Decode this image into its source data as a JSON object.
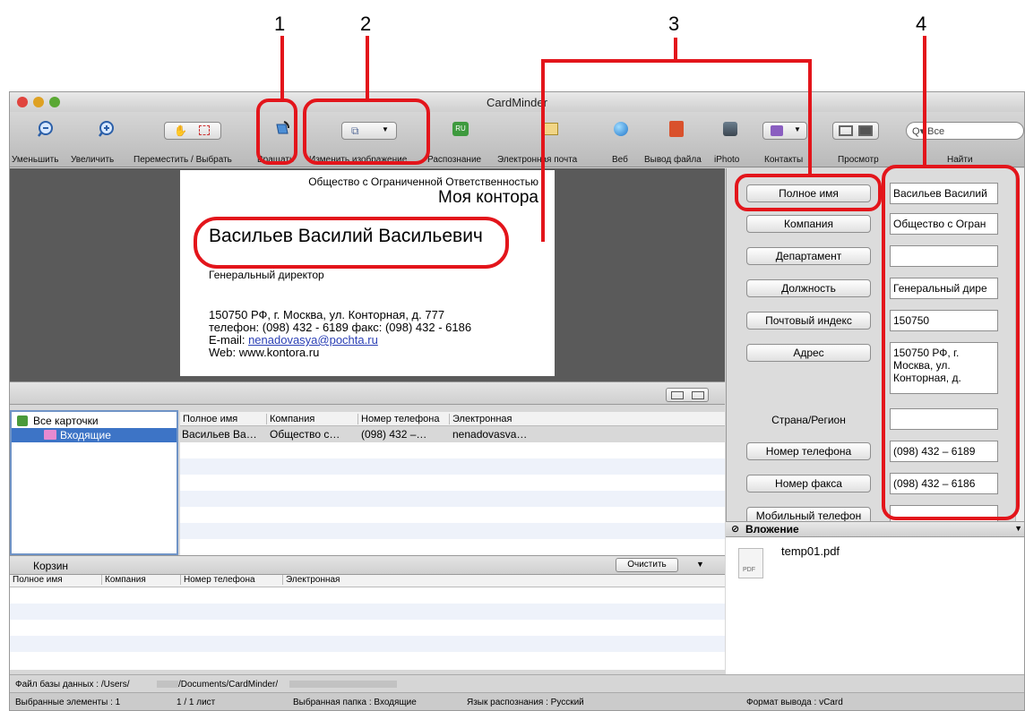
{
  "callouts": [
    "1",
    "2",
    "3",
    "4"
  ],
  "window": {
    "title": "CardMinder"
  },
  "toolbar": {
    "items": [
      {
        "label": "Уменьшить",
        "icon": "zoom-out-icon"
      },
      {
        "label": "Увеличить",
        "icon": "zoom-in-icon"
      },
      {
        "label": "Переместить / Выбрать",
        "icon": "hand-select-icon"
      },
      {
        "label": "Вращать",
        "icon": "rotate-icon"
      },
      {
        "label": "Изменить изображение",
        "icon": "edit-image-icon"
      },
      {
        "label": "Распознание",
        "icon": "recognize-icon"
      },
      {
        "label": "Электронная почта",
        "icon": "mail-icon"
      },
      {
        "label": "Веб",
        "icon": "web-icon"
      },
      {
        "label": "Вывод файла",
        "icon": "file-output-icon"
      },
      {
        "label": "iPhoto",
        "icon": "iphoto-icon"
      },
      {
        "label": "Контакты",
        "icon": "contacts-icon"
      },
      {
        "label": "Просмотр",
        "icon": "view-icon"
      },
      {
        "label": "Найти",
        "icon": "search-icon"
      }
    ],
    "search_placeholder": "Все"
  },
  "card": {
    "company_full": "Общество с Ограниченной Ответственностью",
    "company_name": "Моя контора",
    "person_name": "Васильев Василий Васильевич",
    "position": "Генеральный директор",
    "address": "150750 РФ, г. Москва, ул. Конторная, д. 777",
    "phones": "телефон: (098) 432 - 6189 факс: (098) 432 - 6186",
    "email_label": "E-mail: ",
    "email": "nenadovasya@pochta.ru",
    "web": "Web: www.kontora.ru"
  },
  "tree": {
    "items": [
      {
        "label": "Все карточки",
        "icon": "all-cards-icon"
      },
      {
        "label": "Входящие",
        "icon": "folder-icon"
      }
    ]
  },
  "list": {
    "columns": [
      "Полное имя",
      "Компания",
      "Номер телефона",
      "Электронная"
    ],
    "rows": [
      [
        "Васильев Ва…",
        "Общество с…",
        "(098) 432 –…",
        "nenadovasva…"
      ]
    ]
  },
  "trash": {
    "title": "Корзин",
    "clear_label": "Очистить",
    "columns": [
      "Полное имя",
      "Компания",
      "Номер телефона",
      "Электронная"
    ]
  },
  "fields": {
    "items": [
      {
        "label": "Полное имя",
        "value": "Васильев Василий",
        "button": true
      },
      {
        "label": "Компания",
        "value": "Общество с Огран",
        "button": true
      },
      {
        "label": "Департамент",
        "value": "",
        "button": true
      },
      {
        "label": "Должность",
        "value": "Генеральный дире",
        "button": true
      },
      {
        "label": "Почтовый индекс",
        "value": "150750",
        "button": true
      },
      {
        "label": "Адрес",
        "value": "150750 РФ, г. Москва, ул. Конторная, д.",
        "button": true
      },
      {
        "label": "Страна/Регион",
        "value": "",
        "button": false
      },
      {
        "label": "Номер телефона",
        "value": "(098) 432 – 6189",
        "button": true
      },
      {
        "label": "Номер факса",
        "value": "(098) 432 – 6186",
        "button": true
      },
      {
        "label": "Мобильный телефон",
        "value": "",
        "button": true
      }
    ]
  },
  "attachment": {
    "title": "Вложение",
    "file_name": "temp01.pdf",
    "file_type": "PDF"
  },
  "status": {
    "db_label": "Файл базы данных : /Users/",
    "db_path": "/Documents/CardMinder/",
    "selected": "Выбранные элементы : 1",
    "pages": "1 / 1 лист",
    "folder": "Выбранная папка : Входящие",
    "lang": "Язык распознания : Русский",
    "format": "Формат вывода : vCard"
  },
  "colors": {
    "callout_red": "#e3151b",
    "selection_blue": "#3d74c6"
  }
}
